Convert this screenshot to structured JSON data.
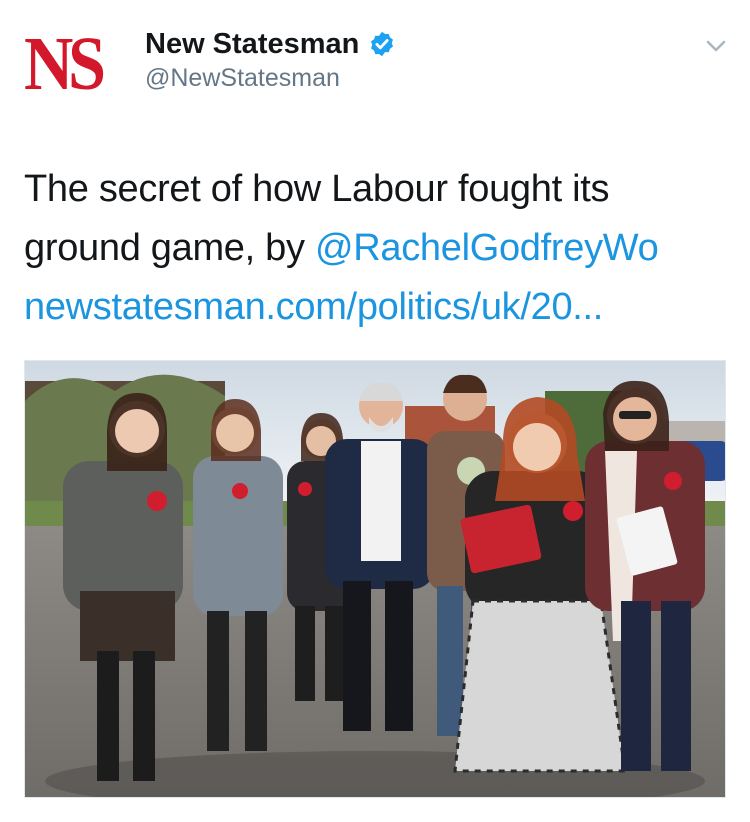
{
  "account": {
    "display_name": "New Statesman",
    "handle": "@NewStatesman",
    "avatar_text": "NS",
    "verified": true
  },
  "tweet": {
    "text_line1": "The secret of how Labour fought its",
    "text_line2_prefix": "ground game, by ",
    "mention": "@RachelGodfreyWo",
    "link": "newstatesman.com/politics/uk/20..."
  },
  "colors": {
    "brand_red": "#d2182a",
    "link_blue": "#1b95e0",
    "verified_blue": "#1da1f2",
    "handle_gray": "#657786"
  },
  "icons": {
    "verified": "verified-badge-icon",
    "menu": "chevron-down-icon"
  }
}
